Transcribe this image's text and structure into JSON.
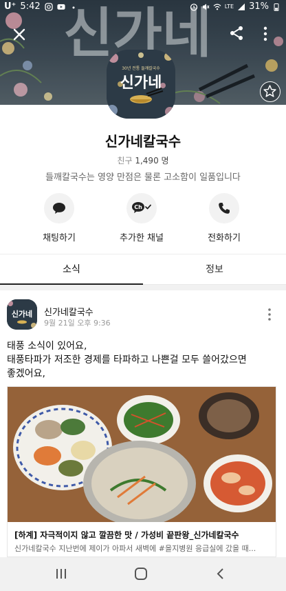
{
  "status_bar": {
    "carrier": "U⁺",
    "time": "5:42",
    "network": "LTE",
    "battery": "31%"
  },
  "cover": {
    "background_text": "신가네"
  },
  "profile": {
    "logo_small_text": "30년 전통 들깨칼국수",
    "logo_text": "신가네",
    "name": "신가네칼국수",
    "friends_label": "친구",
    "friends_count": "1,490 명",
    "intro": "들깨칼국수는 영양 만점은 물론 고소함이 일품입니다"
  },
  "actions": [
    {
      "label": "채팅하기",
      "icon": "chat-bubble-icon"
    },
    {
      "label": "추가한 채널",
      "icon": "channel-added-icon",
      "badge": "Ch"
    },
    {
      "label": "전화하기",
      "icon": "phone-icon"
    }
  ],
  "tabs": [
    {
      "label": "소식",
      "active": true
    },
    {
      "label": "정보",
      "active": false
    }
  ],
  "post": {
    "author": "신가네칼국수",
    "time": "9월 21일 오후 9:36",
    "avatar_text": "신가네",
    "text_lines": [
      "태풍 소식이 있어요,",
      "태풍타파가 저조한 경제를 타파하고 나쁜걸 모두 쓸어갔으면",
      "좋겠어요,"
    ],
    "card": {
      "title": "[하계] 자극적이지 않고 깔끔한 맛 / 가성비 끝판왕_신가네칼국수",
      "desc": "신가네칼국수 지난번에 제이가 아파서 새벽에 #을지병원 응급실에 갔을 때..."
    }
  },
  "colors": {
    "cover_dark": "#2d3a45",
    "tab_indicator": "#222222",
    "action_circle": "#f2f2f2",
    "nav_bg": "#f1f1f1"
  }
}
